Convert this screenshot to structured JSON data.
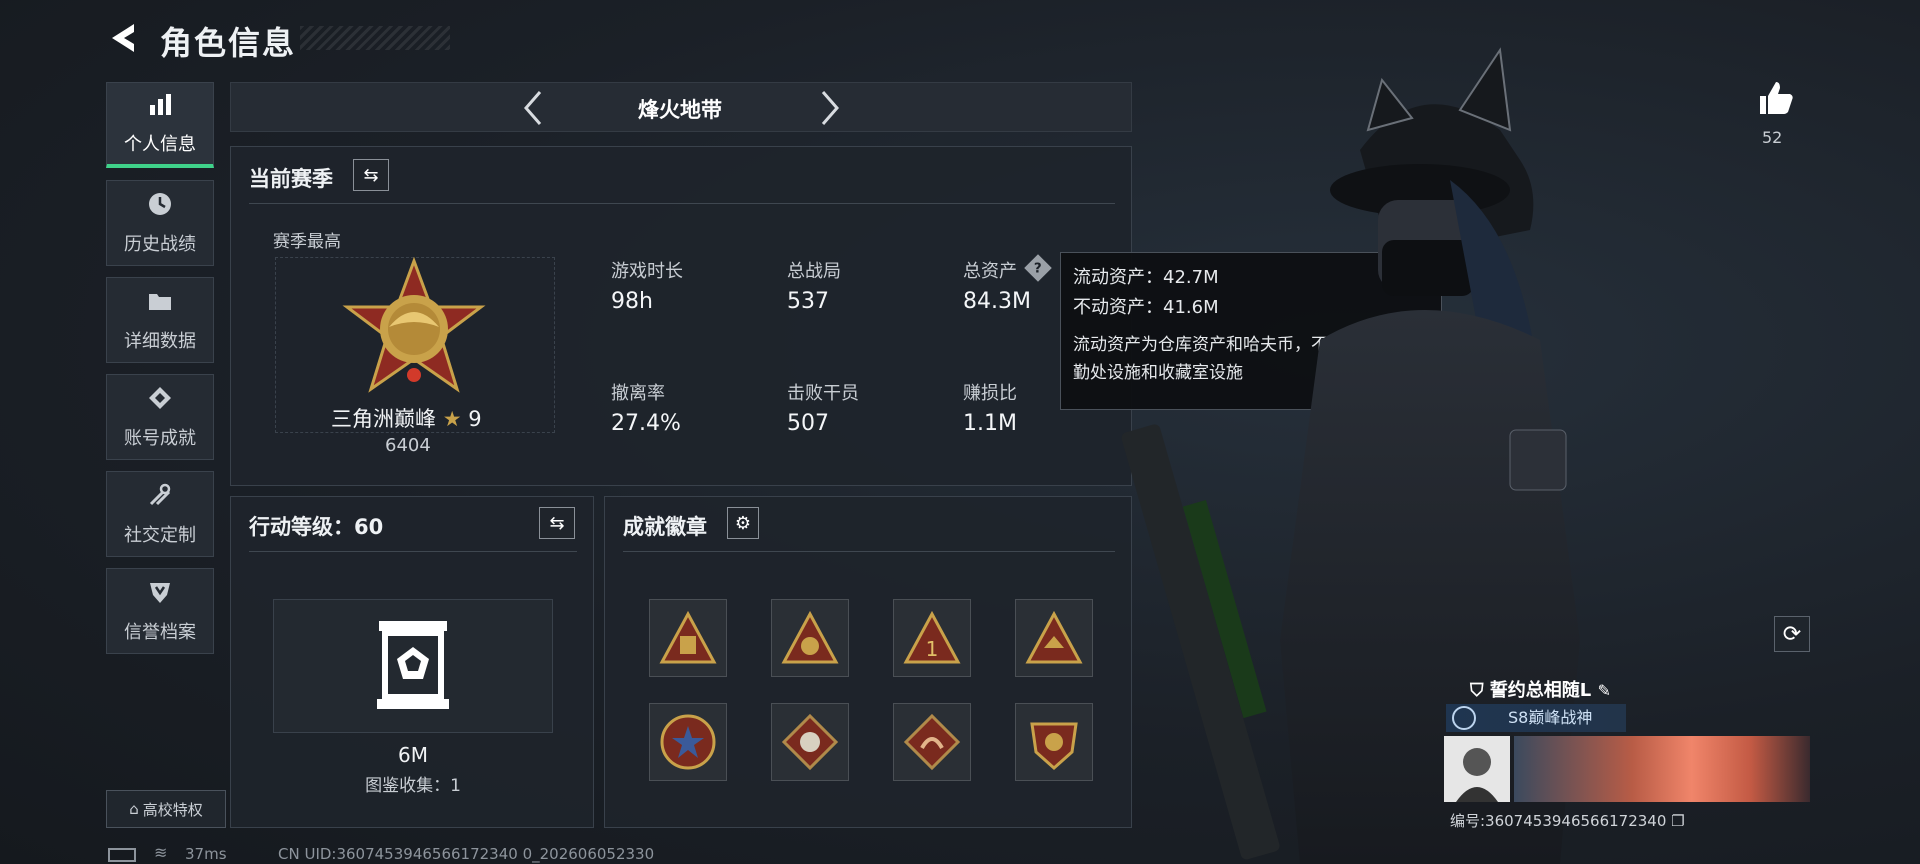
{
  "header": {
    "title": "角色信息"
  },
  "sidebar": {
    "items": [
      {
        "label": "个人信息",
        "icon": "bar-chart-icon",
        "active": true
      },
      {
        "label": "历史战绩",
        "icon": "clock-icon"
      },
      {
        "label": "详细数据",
        "icon": "folder-icon"
      },
      {
        "label": "账号成就",
        "icon": "diamond-badge-icon"
      },
      {
        "label": "社交定制",
        "icon": "wrench-icon"
      },
      {
        "label": "信誉档案",
        "icon": "shield-icon"
      }
    ],
    "school_label": "高校特权"
  },
  "mode": {
    "name": "烽火地带"
  },
  "season": {
    "title": "当前赛季",
    "best_label": "赛季最高",
    "rank_name": "三角洲巅峰",
    "rank_stars": "9",
    "rank_score": "6404",
    "stats": [
      {
        "label": "游戏时长",
        "value": "98h"
      },
      {
        "label": "总战局",
        "value": "537"
      },
      {
        "label": "总资产",
        "value": "84.3M"
      },
      {
        "label": "撤离率",
        "value": "27.4%"
      },
      {
        "label": "击败干员",
        "value": "507"
      },
      {
        "label": "赚损比",
        "value": "1.1M"
      }
    ]
  },
  "tooltip": {
    "liquid": "流动资产：42.7M",
    "fixed": "不动资产：41.6M",
    "desc": "流动资产为仓库资产和哈夫币，不动资产为特勤处设施和收藏室设施"
  },
  "level": {
    "title": "行动等级：60",
    "collection_value": "6M",
    "collection_label": "图鉴收集：1"
  },
  "achievements": {
    "title": "成就徽章",
    "badge_count": 8
  },
  "player": {
    "likes": "52",
    "name": "誓约总相随L",
    "rank_title": "S8巅峰战神",
    "uid_line": "编号:3607453946566172340"
  },
  "footer": {
    "ping": "37ms",
    "cn_uid": "CN UID:3607453946566172340 0_202606052330"
  },
  "colors": {
    "accent_green": "#3fd28a",
    "gold": "#c9a24a"
  }
}
